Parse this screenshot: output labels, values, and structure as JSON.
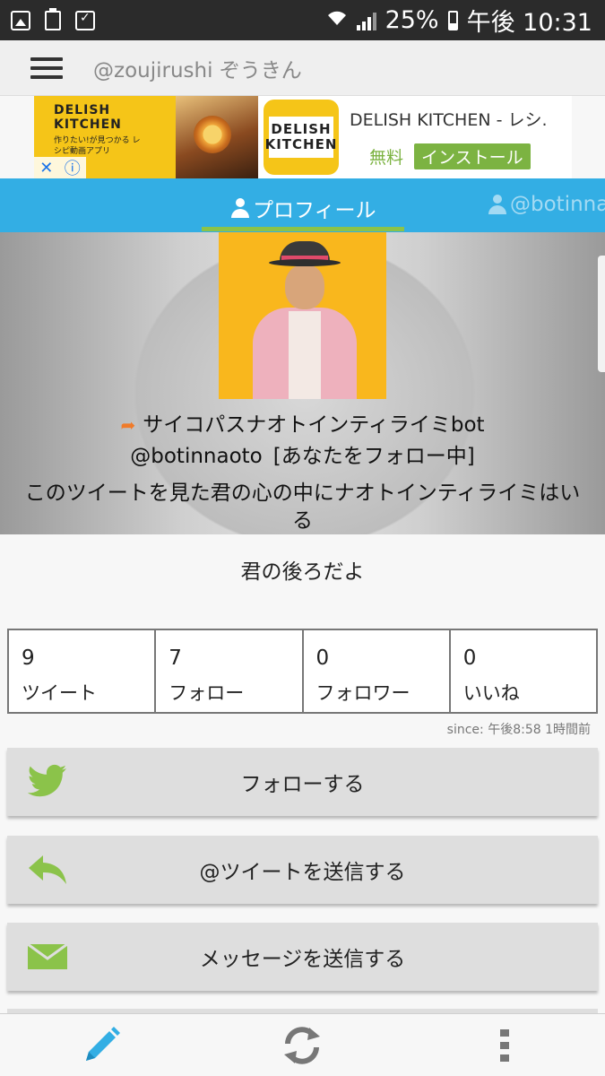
{
  "status_bar": {
    "battery": "25%",
    "time": "午後 10:31",
    "left_icons": [
      "image-icon",
      "clipboard-icon",
      "checklist-icon"
    ],
    "right_icons": [
      "wifi-icon",
      "signal-icon",
      "battery-icon"
    ]
  },
  "app_bar": {
    "title": "@zoujirushi ぞうきん",
    "menu_icon": "hamburger-menu-icon"
  },
  "ad": {
    "image_brand": "DELISH KITCHEN",
    "image_tagline": "作りたい!が見つかる レシピ動画アプリ",
    "logo_line1": "DELISH",
    "logo_line2": "KITCHEN",
    "title": "DELISH KITCHEN - レシ.",
    "price": "無料",
    "install_label": "インストール",
    "close_icon": "ad-close-icon",
    "info_icon": "ad-info-icon"
  },
  "tabs": [
    {
      "label": "プロフィール",
      "active": true
    },
    {
      "label": "@botinnao",
      "active": false
    }
  ],
  "profile": {
    "name": "サイコパスナオトインティライミbot",
    "handle": "@botinnaoto",
    "follow_status": "[あなたをフォロー中]",
    "bio": "このツイートを見た君の心の中にナオトインティライミはいる",
    "location": "君の後ろだよ"
  },
  "stats": [
    {
      "value": "9",
      "label": "ツイート"
    },
    {
      "value": "7",
      "label": "フォロー"
    },
    {
      "value": "0",
      "label": "フォロワー"
    },
    {
      "value": "0",
      "label": "いいね"
    }
  ],
  "since": "since: 午後8:58 1時間前",
  "actions": {
    "follow": "フォローする",
    "mention": "@ツイートを送信する",
    "message": "メッセージを送信する"
  },
  "bottom_bar": {
    "compose_icon": "pencil-icon",
    "refresh_icon": "refresh-icon",
    "more_icon": "more-vertical-icon"
  },
  "colors": {
    "tab_bar": "#33aee4",
    "accent_green": "#8bc34a",
    "ad_yellow": "#f5c518",
    "reply_orange": "#f07b2a"
  }
}
